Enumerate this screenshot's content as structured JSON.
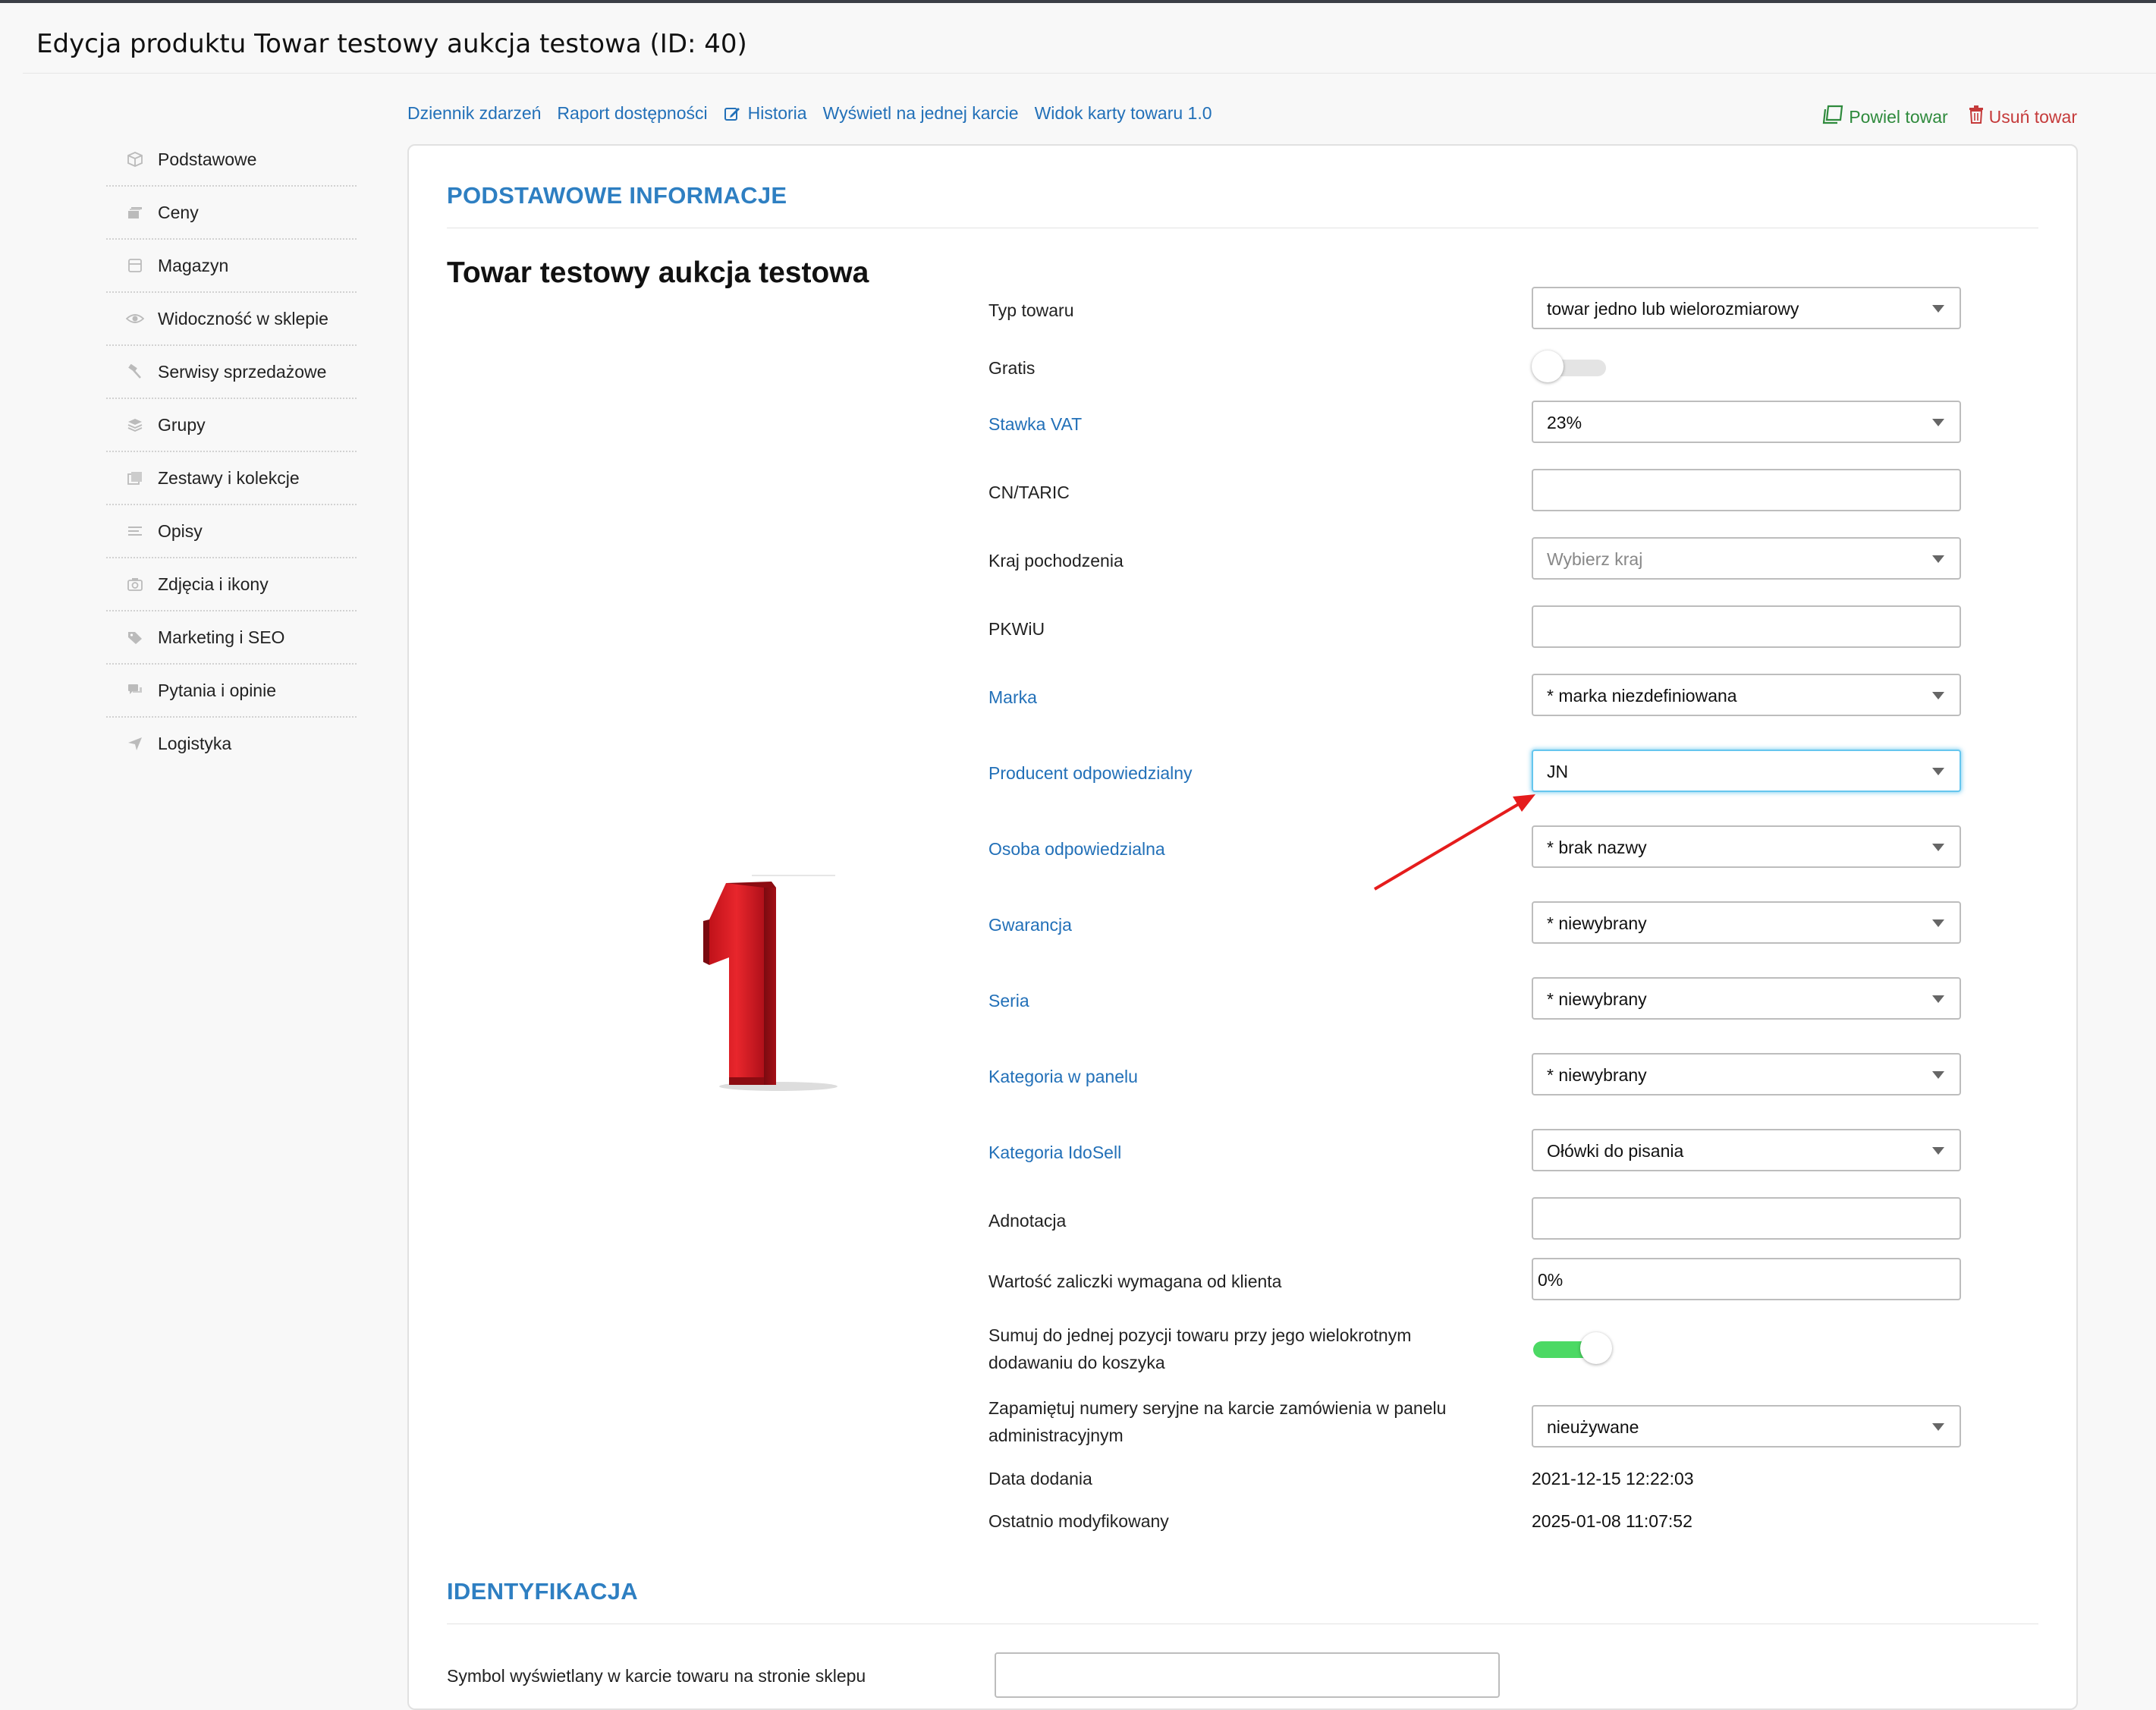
{
  "page": {
    "title": "Edycja produktu Towar testowy aukcja testowa (ID: 40)"
  },
  "sidebar": {
    "items": [
      {
        "label": "Podstawowe",
        "icon": "box-icon"
      },
      {
        "label": "Ceny",
        "icon": "prices-icon"
      },
      {
        "label": "Magazyn",
        "icon": "warehouse-icon"
      },
      {
        "label": "Widoczność w sklepie",
        "icon": "eye-icon"
      },
      {
        "label": "Serwisy sprzedażowe",
        "icon": "hammer-icon"
      },
      {
        "label": "Grupy",
        "icon": "layers-icon"
      },
      {
        "label": "Zestawy i kolekcje",
        "icon": "sets-icon"
      },
      {
        "label": "Opisy",
        "icon": "text-lines-icon"
      },
      {
        "label": "Zdjęcia i ikony",
        "icon": "camera-icon"
      },
      {
        "label": "Marketing i SEO",
        "icon": "tag-icon"
      },
      {
        "label": "Pytania i opinie",
        "icon": "chat-icon"
      },
      {
        "label": "Logistyka",
        "icon": "send-icon"
      }
    ]
  },
  "tabs": {
    "event_log": "Dziennik zdarzeń",
    "availability_report": "Raport dostępności",
    "history": "Historia",
    "single_card": "Wyświetl na jednej karcie",
    "card_view": "Widok karty towaru 1.0"
  },
  "actions": {
    "clone": "Powiel towar",
    "delete": "Usuń towar"
  },
  "colors": {
    "accent": "#2e7fc2",
    "link": "#2270b8",
    "clone": "#2e8a3c",
    "delete": "#c53a3a",
    "toggle_on": "#4cd964",
    "arrow": "#e51c1c"
  },
  "basic_info": {
    "section_title": "PODSTAWOWE INFORMACJE",
    "product_name": "Towar testowy aukcja testowa",
    "product_type": {
      "label": "Typ towaru",
      "value": "towar jedno lub wielorozmiarowy"
    },
    "gratis": {
      "label": "Gratis",
      "on": false
    },
    "vat": {
      "label": "Stawka VAT",
      "value": "23%"
    },
    "cn_taric": {
      "label": "CN/TARIC",
      "value": ""
    },
    "origin_country": {
      "label": "Kraj pochodzenia",
      "placeholder": "Wybierz kraj"
    },
    "pkwiu": {
      "label": "PKWiU",
      "value": ""
    },
    "brand": {
      "label": "Marka",
      "value": "* marka niezdefiniowana"
    },
    "producer": {
      "label": "Producent odpowiedzialny",
      "value": "JN"
    },
    "responsible_person": {
      "label": "Osoba odpowiedzialna",
      "value": "* brak nazwy"
    },
    "warranty": {
      "label": "Gwarancja",
      "value": "* niewybrany"
    },
    "series": {
      "label": "Seria",
      "value": "* niewybrany"
    },
    "panel_category": {
      "label": "Kategoria w panelu",
      "value": "* niewybrany"
    },
    "idosell_category": {
      "label": "Kategoria IdoSell",
      "value": "Ołówki do pisania"
    },
    "annotation": {
      "label": "Adnotacja",
      "value": ""
    },
    "deposit": {
      "label": "Wartość zaliczki wymagana od klienta",
      "value": "0%"
    },
    "sum_cart": {
      "label_line1": "Sumuj do jednej pozycji towaru przy jego wielokrotnym",
      "label_line2": "dodawaniu do koszyka",
      "on": true
    },
    "serial_numbers": {
      "label_line1": "Zapamiętuj numery seryjne na karcie zamówienia w panelu",
      "label_line2": "administracyjnym",
      "value": "nieużywane"
    },
    "date_added": {
      "label": "Data dodania",
      "value": "2021-12-15 12:22:03"
    },
    "last_modified": {
      "label": "Ostatnio modyfikowany",
      "value": "2025-01-08 11:07:52"
    }
  },
  "identification": {
    "section_title": "IDENTYFIKACJA",
    "symbol": {
      "label": "Symbol wyświetlany w karcie towaru na stronie sklepu",
      "value": ""
    }
  }
}
